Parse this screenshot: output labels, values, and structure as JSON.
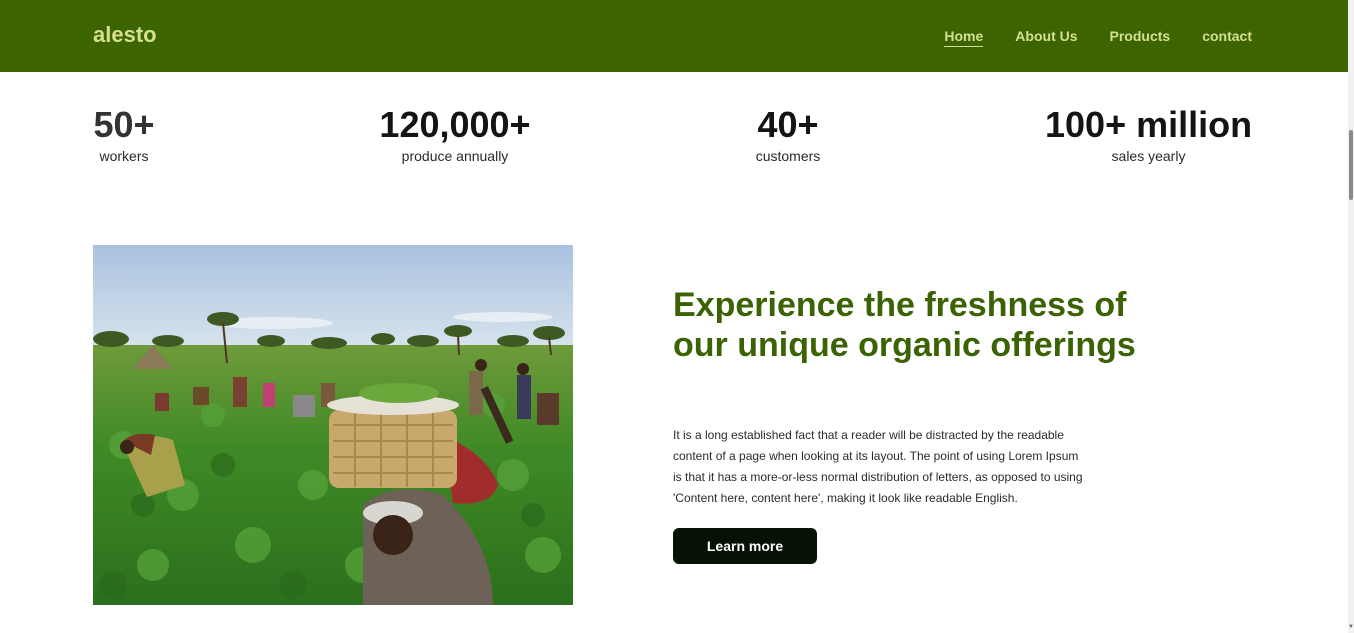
{
  "header": {
    "logo": "alesto",
    "nav": [
      {
        "label": "Home",
        "active": true
      },
      {
        "label": "About Us",
        "active": false
      },
      {
        "label": "Products",
        "active": false
      },
      {
        "label": "contact",
        "active": false
      }
    ]
  },
  "stats": [
    {
      "value": "50+",
      "label": "workers"
    },
    {
      "value": "120,000+",
      "label": "produce annually"
    },
    {
      "value": "40+",
      "label": "customers"
    },
    {
      "value": "100+ million",
      "label": "sales yearly"
    }
  ],
  "feature": {
    "heading": "Experience the freshness of our unique organic offerings",
    "body": "It is a long established fact that a reader will be distracted by the readable content of a page when looking at its layout. The point of using Lorem Ipsum is that it has a more-or-less normal distribution of letters, as opposed to using 'Content here, content here', making it look like readable English.",
    "button_label": "Learn more"
  },
  "colors": {
    "header_bg": "#3c6402",
    "nav_text": "#d6df8e",
    "heading": "#3b6203",
    "button_bg": "#061204"
  }
}
